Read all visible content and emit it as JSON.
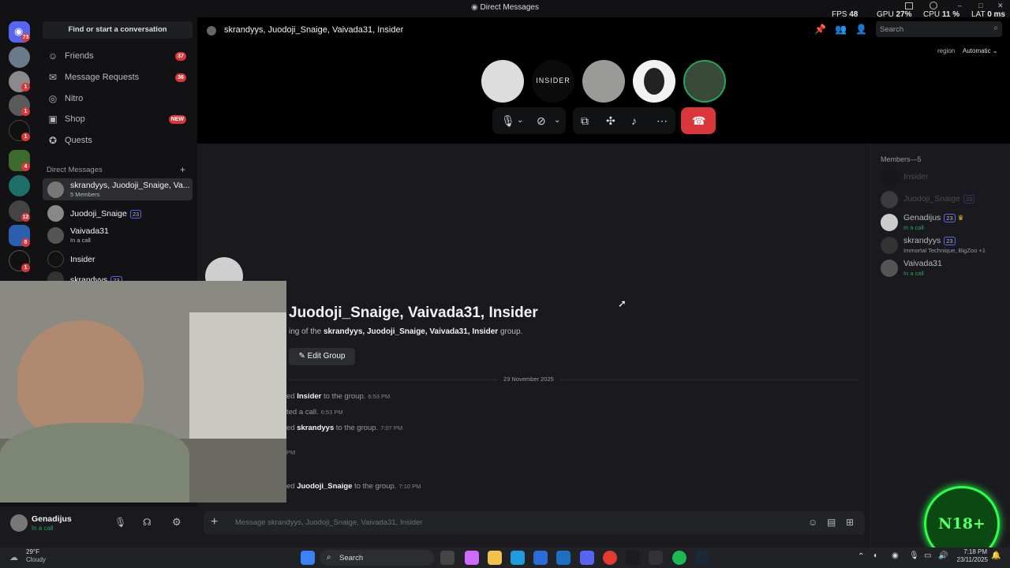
{
  "window": {
    "title": "Direct Messages"
  },
  "overlay": {
    "fps_label": "FPS",
    "fps": "48",
    "gpu_label": "GPU",
    "gpu": "27%",
    "cpu_label": "CPU",
    "cpu": "11 %",
    "lat_label": "LAT",
    "lat": "0 ms"
  },
  "rail": {
    "badges": [
      "73",
      "1",
      "1",
      "1",
      "1",
      "4",
      "12",
      "8",
      "1"
    ]
  },
  "sidebar": {
    "find_placeholder": "Find or start a conversation",
    "nav": [
      {
        "label": "Friends",
        "badge": "37"
      },
      {
        "label": "Message Requests",
        "badge": "36"
      },
      {
        "label": "Nitro",
        "badge": ""
      },
      {
        "label": "Shop",
        "badge": "NEW"
      },
      {
        "label": "Quests",
        "badge": ""
      }
    ],
    "dm_header": "Direct Messages",
    "dms": [
      {
        "name": "skrandyys, Juodoji_Snaige, Va...",
        "sub": "5 Members"
      },
      {
        "name": "Juodoji_Snaige",
        "level": "23",
        "sub": ""
      },
      {
        "name": "Vaivada31",
        "sub": "In a call"
      },
      {
        "name": "Insider",
        "sub": ""
      },
      {
        "name": "skrandyys",
        "level": "23",
        "sub": ""
      }
    ]
  },
  "user": {
    "name": "Genadijus",
    "status": "In a call"
  },
  "header": {
    "title": "skrandyys, Juodoji_Snaige, Vaivada31, Insider",
    "search_placeholder": "Search",
    "region_label": "region",
    "region_value": "Automatic"
  },
  "call": {
    "insider_label": "INSIDER"
  },
  "chat": {
    "group_title": "Juodoji_Snaige, Vaivada31, Insider",
    "intro_prefix": "ing of the",
    "intro_names": "skrandyys, Juodoji_Snaige, Vaivada31, Insider",
    "intro_suffix": "group.",
    "edit_button": "Edit Group",
    "date_divider": "23 November 2025",
    "events": [
      {
        "prefix": "ed",
        "name": "Insider",
        "text": "to the group.",
        "time": "6:53 PM"
      },
      {
        "prefix": "ted a call.",
        "name": "",
        "text": "",
        "time": "6:53 PM"
      },
      {
        "prefix": "ed",
        "name": "skrandyys",
        "text": "to the group.",
        "time": "7:07 PM"
      },
      {
        "prefix": "",
        "name": "",
        "text": "",
        "time": "PM"
      },
      {
        "prefix": "ed",
        "name": "Juodoji_Snaige",
        "text": "to the group.",
        "time": "7:10 PM"
      }
    ],
    "composer_placeholder": "Message skrandyys, Juodoji_Snaige, Vaivada31, Insider"
  },
  "members": {
    "header": "Members—5",
    "list": [
      {
        "name": "Insider",
        "level": "",
        "status": ""
      },
      {
        "name": "Juodoji_Snaige",
        "level": "23",
        "status": ""
      },
      {
        "name": "Genadijus",
        "level": "23",
        "status": "In a call"
      },
      {
        "name": "skrandyys",
        "level": "23",
        "status": "Immortal Technique, BigZoo +1"
      },
      {
        "name": "Vaivada31",
        "level": "",
        "status": "In a call"
      }
    ]
  },
  "badge_n18": "N18+",
  "taskbar": {
    "weather_temp": "29°F",
    "weather_desc": "Cloudy",
    "search_label": "Search",
    "time": "7:18 PM",
    "date": "23/11/2025"
  }
}
